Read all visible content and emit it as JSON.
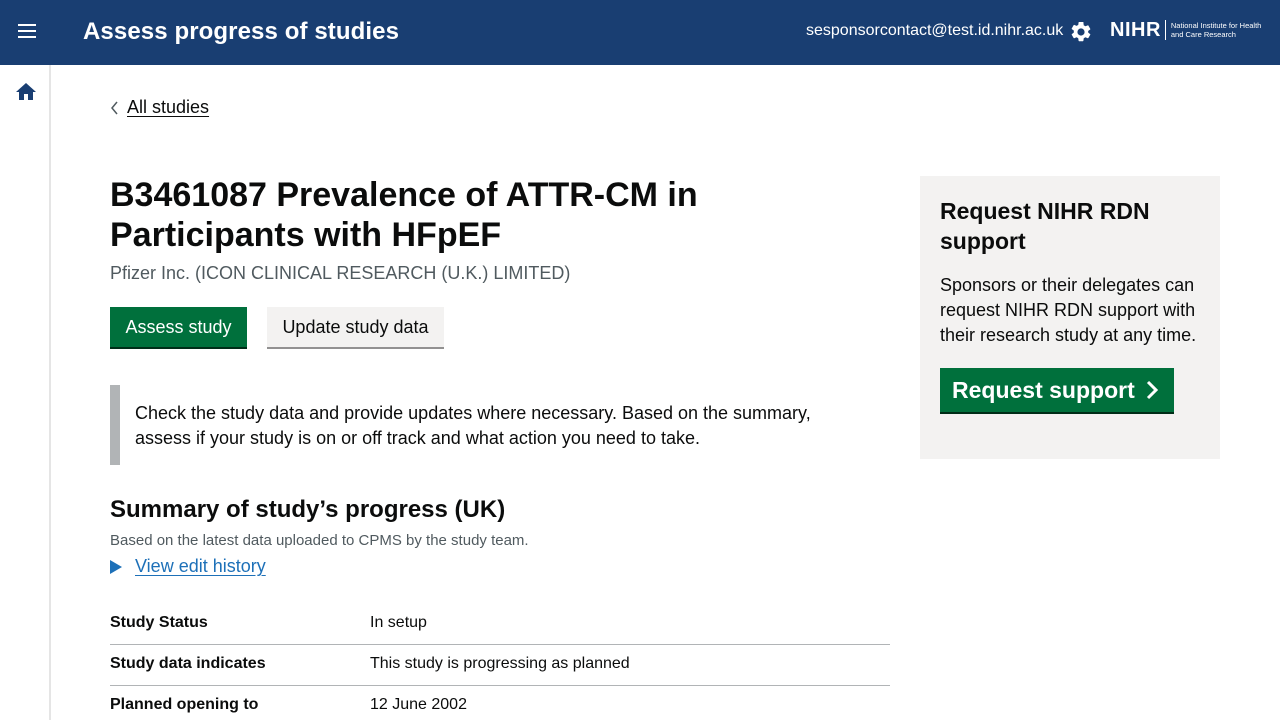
{
  "header": {
    "title": "Assess progress of studies",
    "user_email": "sesponsorcontact@test.id.nihr.ac.uk",
    "logo_text": "NIHR",
    "logo_subtext": "National Institute for Health and Care Research",
    "menu_icon": "menu-icon",
    "settings_icon": "gear-icon"
  },
  "sidenav": {
    "home_icon": "home-icon"
  },
  "back_link": {
    "label": "All studies"
  },
  "study": {
    "title": "B3461087 Prevalence of ATTR-CM in Participants with HFpEF",
    "sponsor": "Pfizer Inc. (ICON CLINICAL RESEARCH (U.K.) LIMITED)"
  },
  "actions": {
    "assess_label": "Assess study",
    "update_label": "Update study data"
  },
  "inset_text": "Check the study data and provide updates where necessary. Based on the summary, assess if your study is on or off track and what action you need to take.",
  "summary": {
    "title": "Summary of study’s progress (UK)",
    "subtitle": "Based on the latest data uploaded to CPMS by the study team.",
    "history_link": "View edit history",
    "rows": [
      {
        "key": "Study Status",
        "value": "In setup"
      },
      {
        "key": "Study data indicates",
        "value": "This study is progressing as planned"
      },
      {
        "key": "Planned opening to",
        "value": "12 June 2002"
      }
    ]
  },
  "support_panel": {
    "title": "Request NIHR RDN support",
    "body": "Sponsors or their delegates can request NIHR RDN support with their research study at any time.",
    "button_label": "Request support"
  },
  "colors": {
    "header_bg": "#193e72",
    "primary_button": "#00703c",
    "link": "#1d70b8",
    "panel_bg": "#f3f2f1"
  }
}
